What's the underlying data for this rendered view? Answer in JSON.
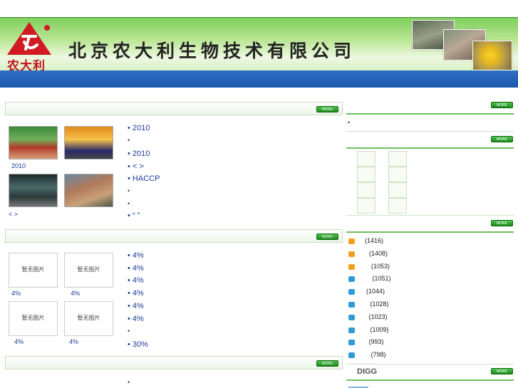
{
  "header": {
    "logo_text": "农大利",
    "company_name": "北京农大利生物技术有限公司"
  },
  "more_label": "MORE",
  "section1": {
    "photo_caption": "2010",
    "pager": "<  >",
    "items": [
      "•   2010",
      "•",
      "• 2010",
      "• <   >",
      "•        HACCP",
      "•",
      "•",
      "• “    ”"
    ]
  },
  "section2": {
    "no_image_label": "暂无图片",
    "captions": [
      "4%",
      "4%",
      "4%",
      "4%"
    ],
    "items": [
      "•   4%",
      "•     4%",
      "•     4%",
      "•     4%",
      "•   4%",
      "•   4%",
      "•",
      "• 30%"
    ]
  },
  "section3": {
    "items": [
      "•"
    ]
  },
  "right": {
    "block1_item": "•",
    "ranking": [
      {
        "count": "(1416)",
        "color": "#f0a11c"
      },
      {
        "count": "(1408)",
        "color": "#f0a11c"
      },
      {
        "count": "(1053)",
        "color": "#f0a11c"
      },
      {
        "count": "(1051)",
        "color": "#2e9ad6"
      },
      {
        "count": "(1044)",
        "color": "#2e9ad6"
      },
      {
        "count": "(1028)",
        "color": "#2e9ad6"
      },
      {
        "count": "(1023)",
        "color": "#2e9ad6"
      },
      {
        "count": "(1009)",
        "color": "#2e9ad6"
      },
      {
        "count": "(993)",
        "color": "#2e9ad6"
      },
      {
        "count": "(798)",
        "color": "#2e9ad6"
      }
    ],
    "digg_title": "DIGG"
  }
}
